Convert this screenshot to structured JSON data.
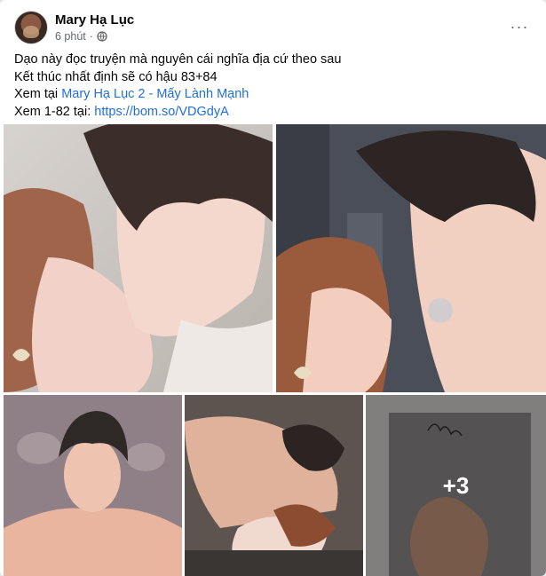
{
  "post": {
    "author": "Mary Hạ Lục",
    "time": "6 phút",
    "separator": "·",
    "privacy_icon": "globe-icon",
    "more_icon": "more-options-icon",
    "more_glyph": "···"
  },
  "body": {
    "line1": "Dạo này đọc truyện mà nguyên cái nghĩa địa cứ theo sau",
    "line2": "Kết thúc nhất định sẽ có hậu 83+84",
    "line3_prefix": "Xem tại ",
    "line3_link": "Mary Hạ Lục 2 - Mấy Lành Mạnh",
    "line4_prefix": "Xem 1-82 tại: ",
    "line4_link": "https://bom.so/VDGdyA"
  },
  "photos": {
    "more_count": "+3"
  },
  "colors": {
    "link": "#216fdb",
    "meta": "#65676b"
  }
}
